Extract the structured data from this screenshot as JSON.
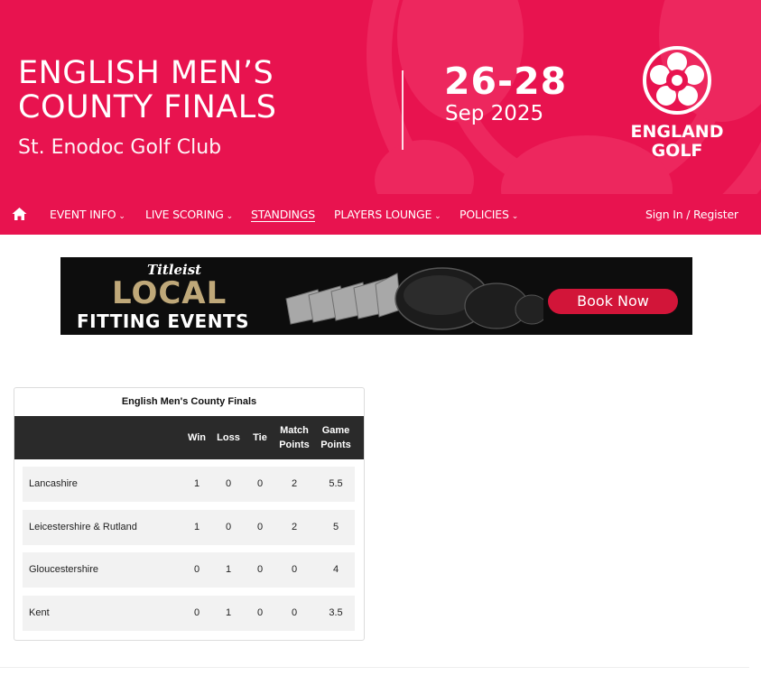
{
  "event": {
    "title_line1": "ENGLISH MEN’S",
    "title_line2": "COUNTY FINALS",
    "venue": "St. Enodoc Golf Club",
    "dates": "26-28",
    "month_year": "Sep 2025",
    "logo_line1": "ENGLAND",
    "logo_line2": "GOLF"
  },
  "colors": {
    "brand": "#e8134f",
    "header_dark": "#2a2a2a",
    "row_bg": "#f2f2f2"
  },
  "nav": {
    "home_icon": "home-icon",
    "event_info": "EVENT INFO",
    "live_scoring": "LIVE SCORING",
    "standings": "STANDINGS",
    "players_lounge": "PLAYERS LOUNGE",
    "policies": "POLICIES",
    "chevron": "⌄",
    "sign_in": "Sign In / Register"
  },
  "ad": {
    "brand": "Titleist",
    "line1": "LOCAL",
    "line2": "FITTING EVENTS",
    "cta": "Book Now"
  },
  "standings": {
    "title": "English Men's County Finals",
    "columns": {
      "win": "Win",
      "loss": "Loss",
      "tie": "Tie",
      "match_l1": "Match",
      "match_l2": "Points",
      "game_l1": "Game",
      "game_l2": "Points"
    },
    "rows": [
      {
        "team": "Lancashire",
        "win": "1",
        "loss": "0",
        "tie": "0",
        "match": "2",
        "game": "5.5"
      },
      {
        "team": "Leicestershire & Rutland",
        "win": "1",
        "loss": "0",
        "tie": "0",
        "match": "2",
        "game": "5"
      },
      {
        "team": "Gloucestershire",
        "win": "0",
        "loss": "1",
        "tie": "0",
        "match": "0",
        "game": "4"
      },
      {
        "team": "Kent",
        "win": "0",
        "loss": "1",
        "tie": "0",
        "match": "0",
        "game": "3.5"
      }
    ]
  }
}
